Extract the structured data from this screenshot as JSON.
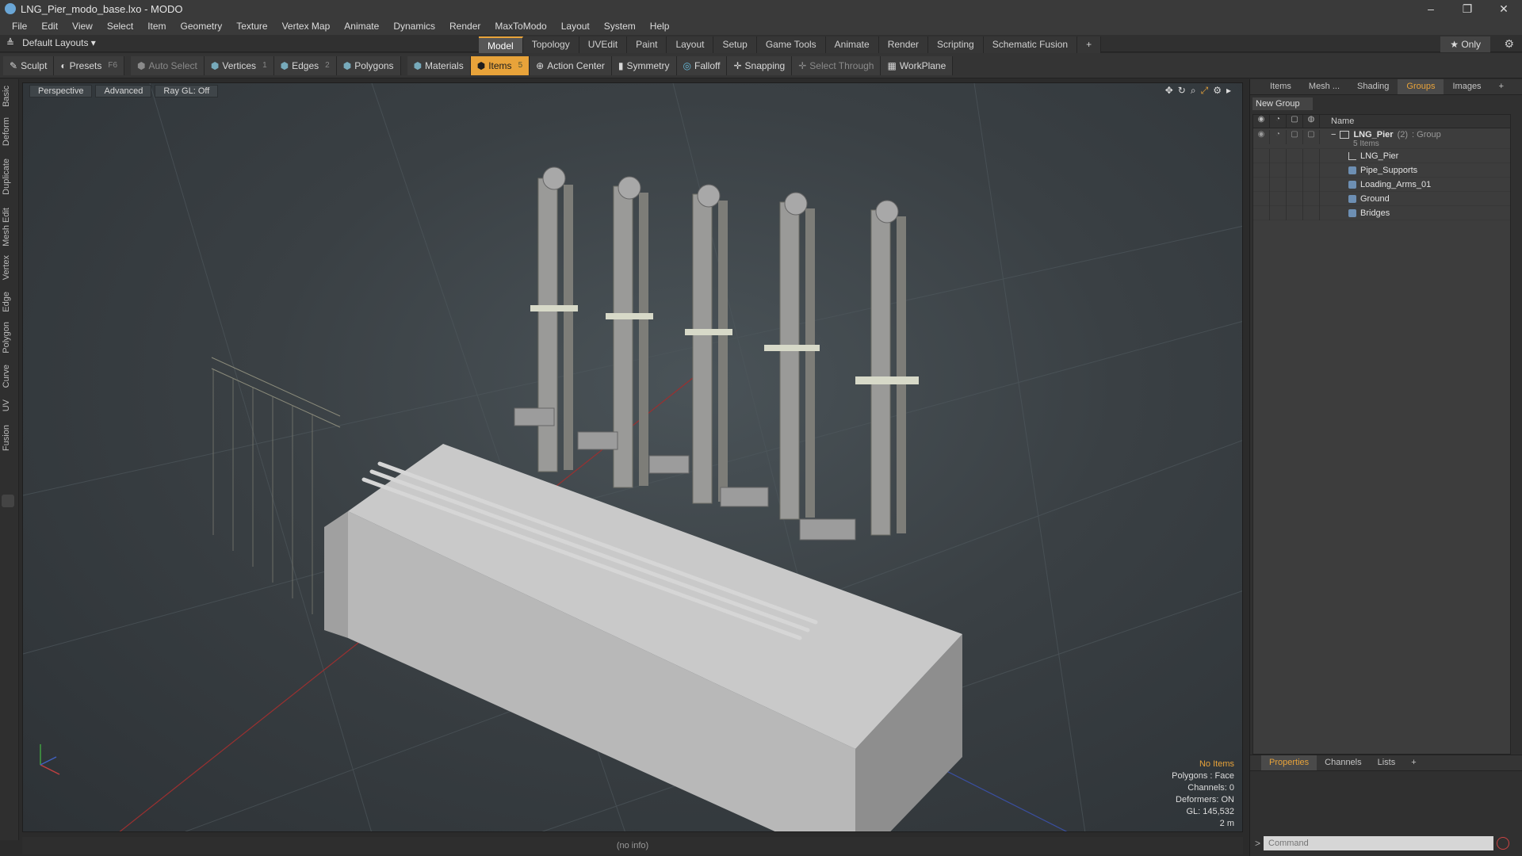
{
  "window": {
    "title": "LNG_Pier_modo_base.lxo - MODO",
    "minimize": "–",
    "restore": "❐",
    "close": "✕"
  },
  "menu": [
    "File",
    "Edit",
    "View",
    "Select",
    "Item",
    "Geometry",
    "Texture",
    "Vertex Map",
    "Animate",
    "Dynamics",
    "Render",
    "MaxToModo",
    "Layout",
    "System",
    "Help"
  ],
  "layout": {
    "selector": "Default Layouts ▾"
  },
  "tabs": [
    {
      "label": "Model",
      "active": true
    },
    {
      "label": "Topology"
    },
    {
      "label": "UVEdit"
    },
    {
      "label": "Paint"
    },
    {
      "label": "Layout"
    },
    {
      "label": "Setup"
    },
    {
      "label": "Game Tools"
    },
    {
      "label": "Animate"
    },
    {
      "label": "Render"
    },
    {
      "label": "Scripting"
    },
    {
      "label": "Schematic Fusion"
    },
    {
      "label": "+"
    }
  ],
  "only_button": "★ Only",
  "toolbar": {
    "sculpt": "Sculpt",
    "presets": "Presets",
    "presets_key": "F6",
    "auto_select": "Auto Select",
    "vertices": "Vertices",
    "vertices_key": "1",
    "edges": "Edges",
    "edges_key": "2",
    "polygons": "Polygons",
    "materials": "Materials",
    "items": "Items",
    "items_key": "5",
    "action_center": "Action Center",
    "symmetry": "Symmetry",
    "falloff": "Falloff",
    "snapping": "Snapping",
    "select_through": "Select Through",
    "workplane": "WorkPlane"
  },
  "left_tabs": [
    "Basic",
    "Deform",
    "Duplicate",
    "Mesh Edit",
    "Vertex",
    "Edge",
    "Polygon",
    "Curve",
    "UV",
    "Fusion"
  ],
  "viewport": {
    "perspective": "Perspective",
    "advanced": "Advanced",
    "raygl": "Ray GL: Off",
    "info": {
      "no_items": "No Items",
      "polygons": "Polygons : Face",
      "channels": "Channels: 0",
      "deformers": "Deformers: ON",
      "gl": "GL: 145,532",
      "scale": "2 m"
    }
  },
  "status": "(no info)",
  "right_panel": {
    "tabs": [
      {
        "label": "Items"
      },
      {
        "label": "Mesh ..."
      },
      {
        "label": "Shading"
      },
      {
        "label": "Groups",
        "active": true
      },
      {
        "label": "Images"
      },
      {
        "label": "+"
      }
    ],
    "new_group": "New Group",
    "name_header": "Name",
    "group": {
      "name": "LNG_Pier",
      "count": "(2)",
      "type": ": Group",
      "subtitle": "5 Items"
    },
    "items": [
      "LNG_Pier",
      "Pipe_Supports",
      "Loading_Arms_01",
      "Ground",
      "Bridges"
    ]
  },
  "properties": {
    "tabs": [
      {
        "label": "Properties",
        "active": true
      },
      {
        "label": "Channels"
      },
      {
        "label": "Lists"
      },
      {
        "label": "+"
      }
    ],
    "command_placeholder": "Command"
  },
  "colors": {
    "accent": "#e8a33a",
    "panel": "#303030",
    "viewport": "#3a4044"
  }
}
